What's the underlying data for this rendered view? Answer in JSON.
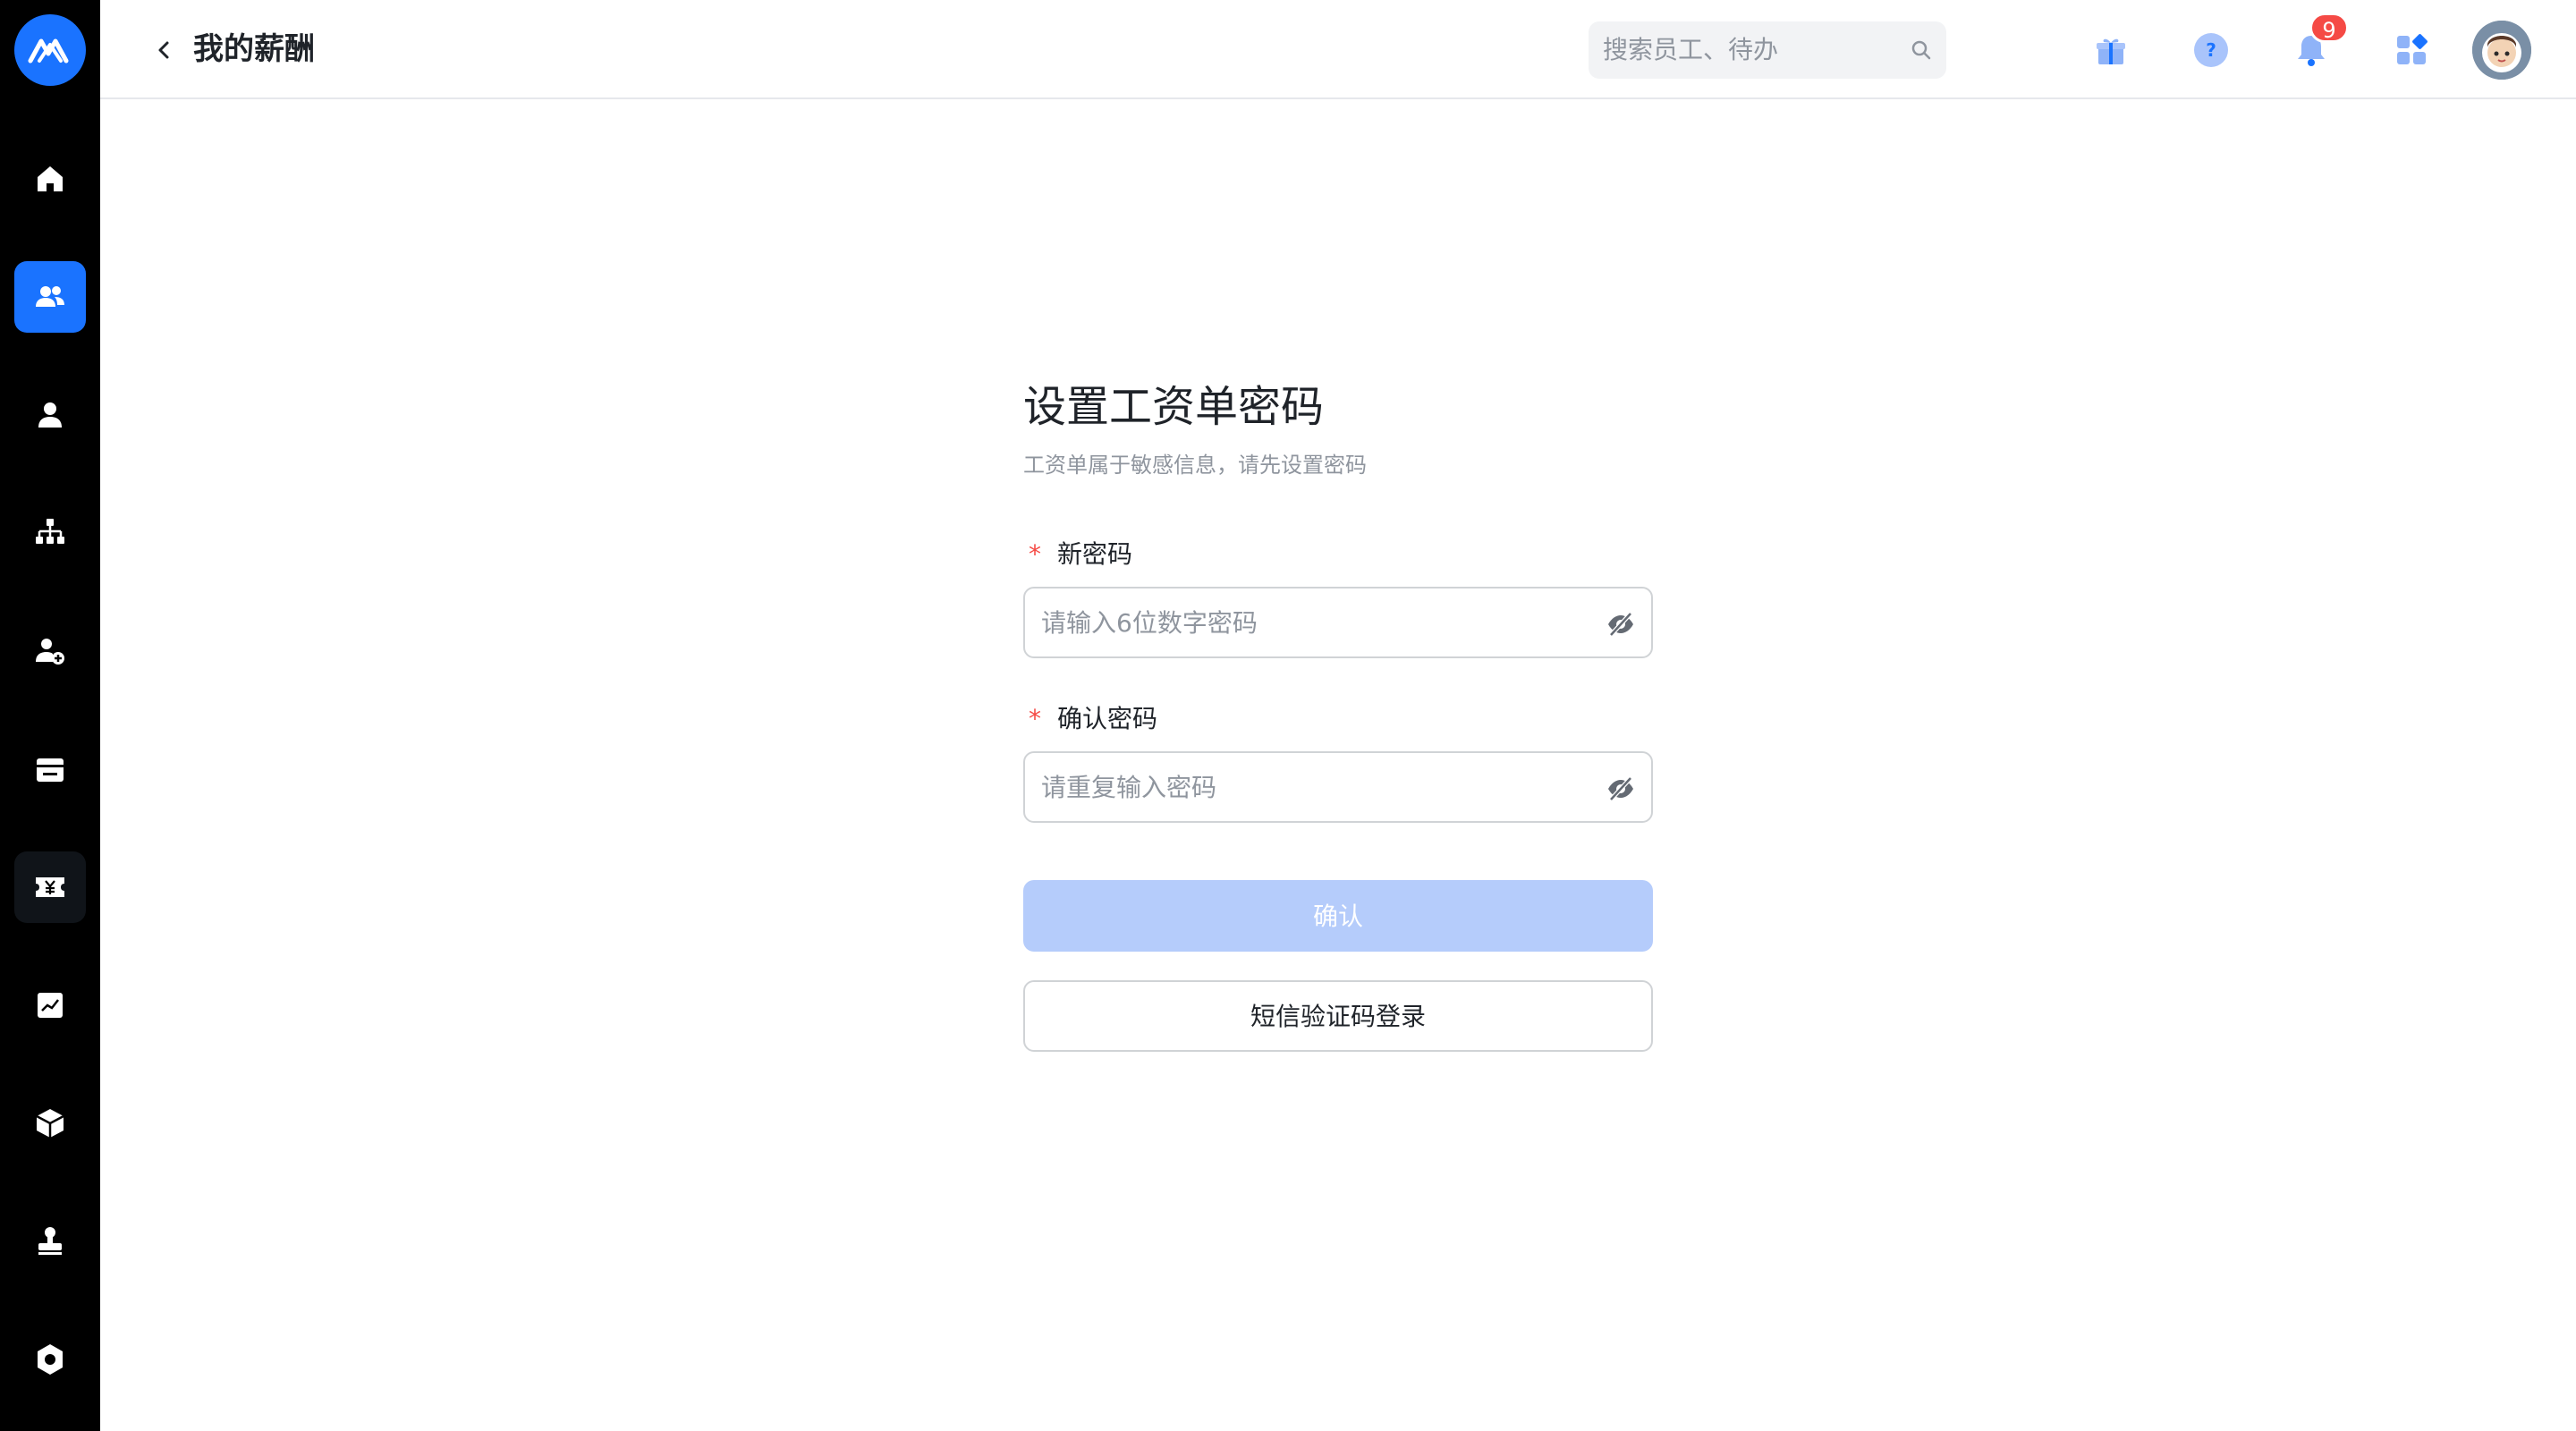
{
  "header": {
    "title": "我的薪酬",
    "search_placeholder": "搜索员工、待办",
    "notification_count": "9"
  },
  "sidebar": {
    "items": [
      {
        "icon": "home-icon"
      },
      {
        "icon": "team-icon",
        "active": true
      },
      {
        "icon": "person-icon"
      },
      {
        "icon": "org-chart-icon"
      },
      {
        "icon": "add-person-icon"
      },
      {
        "icon": "calendar-icon"
      },
      {
        "icon": "salary-icon"
      },
      {
        "icon": "report-icon"
      },
      {
        "icon": "cube-icon"
      },
      {
        "icon": "stamp-icon"
      },
      {
        "icon": "settings-icon"
      }
    ]
  },
  "form": {
    "title": "设置工资单密码",
    "subtitle": "工资单属于敏感信息，请先设置密码",
    "required_mark": "*",
    "new_password_label": "新密码",
    "new_password_placeholder": "请输入6位数字密码",
    "confirm_password_label": "确认密码",
    "confirm_password_placeholder": "请重复输入密码",
    "confirm_button": "确认",
    "sms_button": "短信验证码登录"
  },
  "colors": {
    "brand": "#1a73ff",
    "sidebar_bg": "#000000",
    "confirm_disabled": "#b5ccfb",
    "required": "#f54a45",
    "badge": "#f54a45"
  }
}
